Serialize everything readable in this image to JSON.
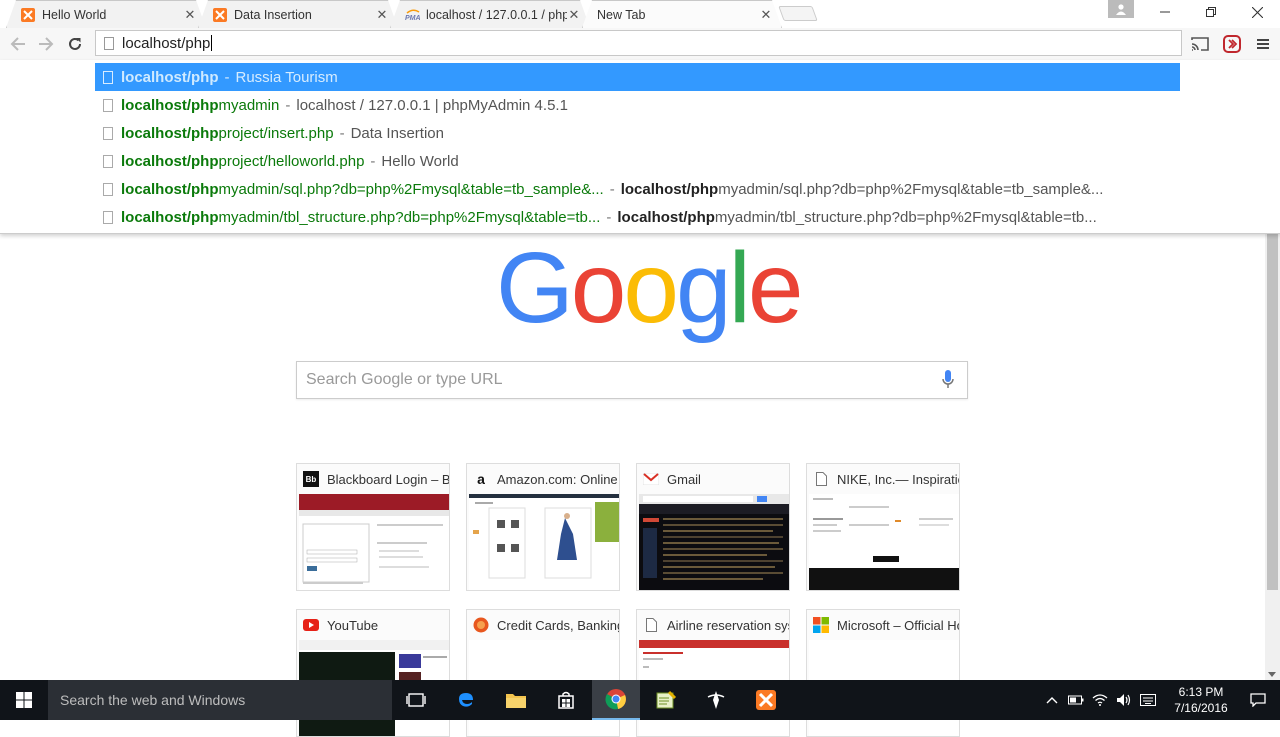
{
  "tabs": [
    {
      "title": "Hello World",
      "active": false
    },
    {
      "title": "Data Insertion",
      "active": false
    },
    {
      "title": "localhost / 127.0.0.1 / php",
      "active": false
    },
    {
      "title": "New Tab",
      "active": true
    }
  ],
  "omnibox": {
    "typed": "localhost/php"
  },
  "suggestions": [
    {
      "match": "localhost/php",
      "rest": "",
      "desc": "Russia Tourism",
      "desc_match": "",
      "desc_rest": ""
    },
    {
      "match": "localhost/php",
      "rest": "myadmin",
      "desc": "localhost / 127.0.0.1 | phpMyAdmin 4.5.1",
      "desc_match": "",
      "desc_rest": ""
    },
    {
      "match": "localhost/php",
      "rest": "project/insert.php",
      "desc": "Data Insertion",
      "desc_match": "",
      "desc_rest": ""
    },
    {
      "match": "localhost/php",
      "rest": "project/helloworld.php",
      "desc": "Hello World",
      "desc_match": "",
      "desc_rest": ""
    },
    {
      "match": "localhost/php",
      "rest": "myadmin/sql.php?db=php%2Fmysql&table=tb_sample&...",
      "desc": "",
      "desc_match": "localhost/php",
      "desc_rest": "myadmin/sql.php?db=php%2Fmysql&table=tb_sample&..."
    },
    {
      "match": "localhost/php",
      "rest": "myadmin/tbl_structure.php?db=php%2Fmysql&table=tb...",
      "desc": "",
      "desc_match": "localhost/php",
      "desc_rest": "myadmin/tbl_structure.php?db=php%2Fmysql&table=tb..."
    }
  ],
  "ntp": {
    "logo_letters": [
      "G",
      "o",
      "o",
      "g",
      "l",
      "e"
    ],
    "logo_colors": [
      "#4285f4",
      "#ea4335",
      "#fbbc05",
      "#4285f4",
      "#34a853",
      "#ea4335"
    ],
    "search_placeholder": "Search Google or type URL"
  },
  "tiles": [
    {
      "title": "Blackboard Login – Bl",
      "icon": "blackboard-icon"
    },
    {
      "title": "Amazon.com: Online",
      "icon": "amazon-icon"
    },
    {
      "title": "Gmail",
      "icon": "gmail-icon"
    },
    {
      "title": "NIKE, Inc.— Inspiratio",
      "icon": "page-icon"
    },
    {
      "title": "YouTube",
      "icon": "youtube-icon"
    },
    {
      "title": "Credit Cards, Banking",
      "icon": "bank-icon"
    },
    {
      "title": "Airline reservation sys",
      "icon": "page-icon"
    },
    {
      "title": "Microsoft – Official Ho",
      "icon": "microsoft-icon"
    }
  ],
  "taskbar": {
    "search_placeholder": "Search the web and Windows",
    "time": "6:13 PM",
    "date": "7/16/2016"
  },
  "colors": {
    "selected_suggestion": "#3399ff",
    "url_green": "#0b7a0b",
    "taskbar": "#101419"
  }
}
